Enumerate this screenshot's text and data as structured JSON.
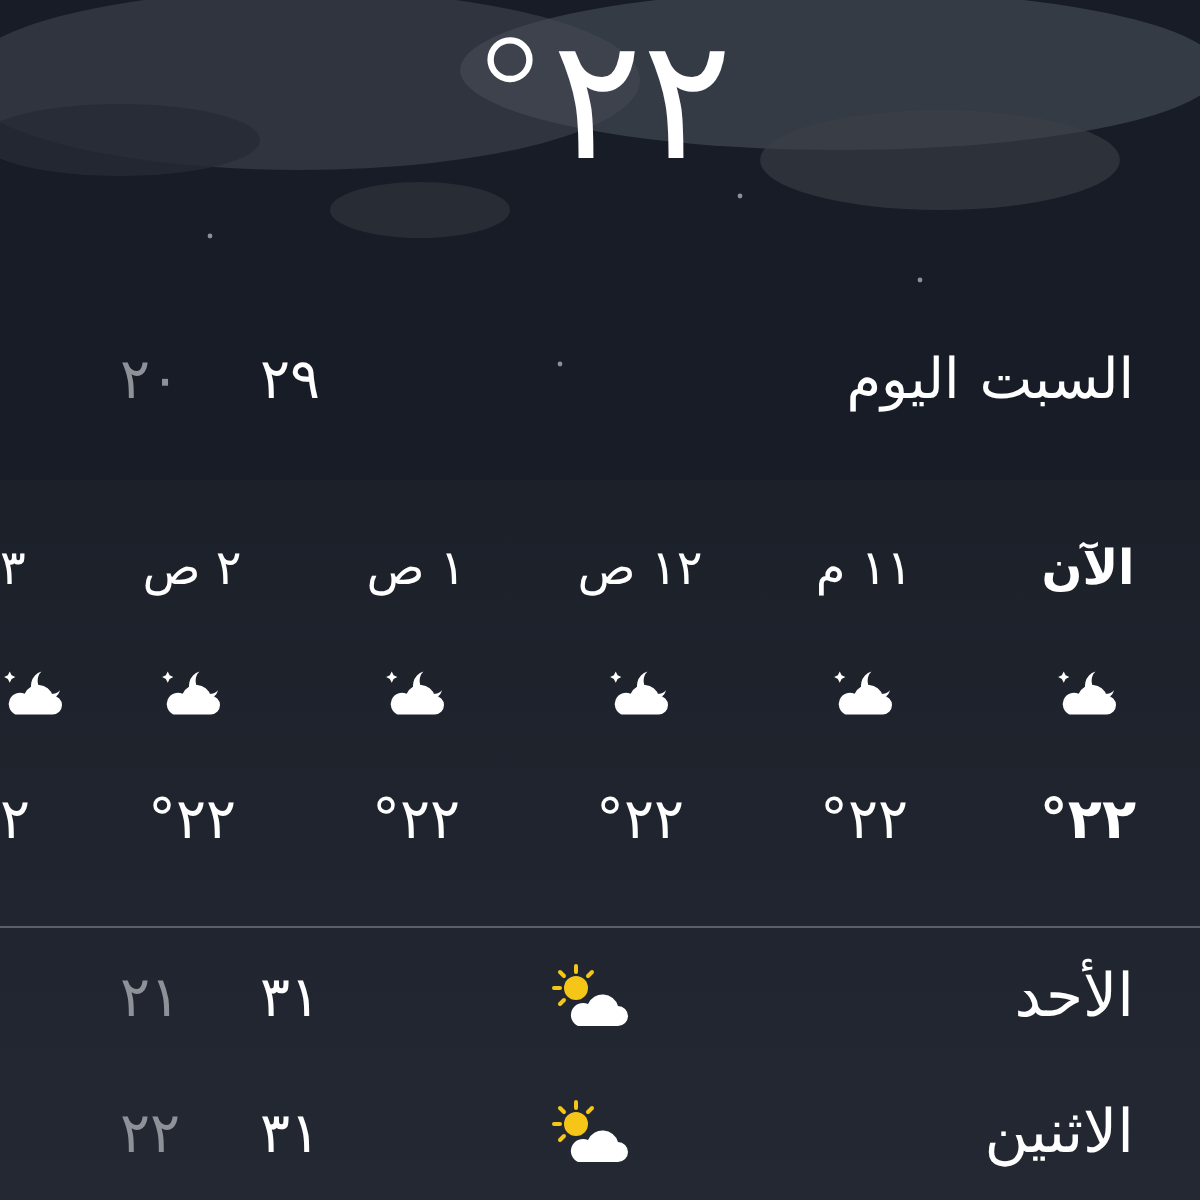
{
  "current": {
    "temperature": "٢٢°"
  },
  "today": {
    "day": "السبت",
    "label": "اليوم",
    "high": "٢٩",
    "low": "٢٠"
  },
  "hourly": [
    {
      "time": "الآن",
      "kind": "cloud-moon",
      "temperature": "٢٢°",
      "now": true
    },
    {
      "time": "١١ م",
      "kind": "cloud-moon",
      "temperature": "٢٢°",
      "now": false
    },
    {
      "time": "١٢ ص",
      "kind": "cloud-moon",
      "temperature": "٢٢°",
      "now": false
    },
    {
      "time": "١ ص",
      "kind": "cloud-moon",
      "temperature": "٢٢°",
      "now": false
    },
    {
      "time": "٢ ص",
      "kind": "cloud-moon",
      "temperature": "٢٢°",
      "now": false
    },
    {
      "time": "٣",
      "kind": "cloud-moon",
      "temperature": "٢",
      "now": false
    }
  ],
  "daily": [
    {
      "day": "الأحد",
      "kind": "sun-cloud",
      "high": "٣١",
      "low": "٢١"
    },
    {
      "day": "الاثنين",
      "kind": "sun-cloud",
      "high": "٣١",
      "low": "٢٢"
    }
  ]
}
